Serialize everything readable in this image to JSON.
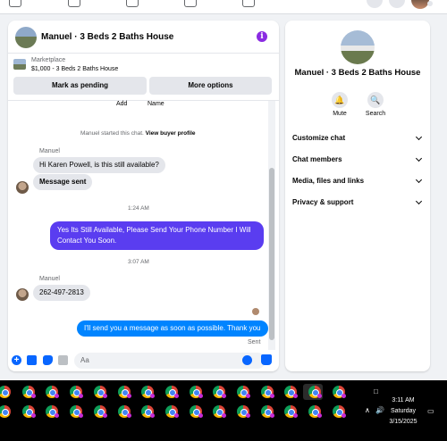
{
  "chat": {
    "title": "Manuel · 3 Beds 2 Baths House",
    "marketplace_label": "Marketplace",
    "listing": "$1,000 - 3 Beds 2 Baths House",
    "mark_pending": "Mark as pending",
    "more_options": "More options",
    "partial_add": "Add",
    "partial_name": "Name",
    "started_text": "Manuel started this chat.",
    "view_profile": "View buyer profile",
    "messages": [
      {
        "sender": "Manuel",
        "text": "Hi Karen Powell, is this still available?"
      },
      {
        "text": "Message sent"
      },
      {
        "time": "1:24 AM"
      },
      {
        "text": "Yes Its Still Available, Please Send Your Phone Number I Will Contact You Soon."
      },
      {
        "time": "3:07 AM"
      },
      {
        "sender": "Manuel",
        "text": "262-497-2813"
      },
      {
        "text": "I'll send you a message as soon as possible. Thank you"
      },
      {
        "status": "Sent"
      }
    ],
    "composer_placeholder": "Aa"
  },
  "info": {
    "title": "Manuel · 3 Beds 2 Baths House",
    "mute": "Mute",
    "search": "Search",
    "menu": [
      "Customize chat",
      "Chat members",
      "Media, files and links",
      "Privacy & support"
    ]
  },
  "taskbar": {
    "time": "3:11 AM",
    "day": "Saturday",
    "date": "3/15/2025"
  },
  "colors": {
    "outgoing_bubble": "#0a7cff",
    "purple_bubble": "#5a3df0",
    "accent": "#0866ff"
  }
}
